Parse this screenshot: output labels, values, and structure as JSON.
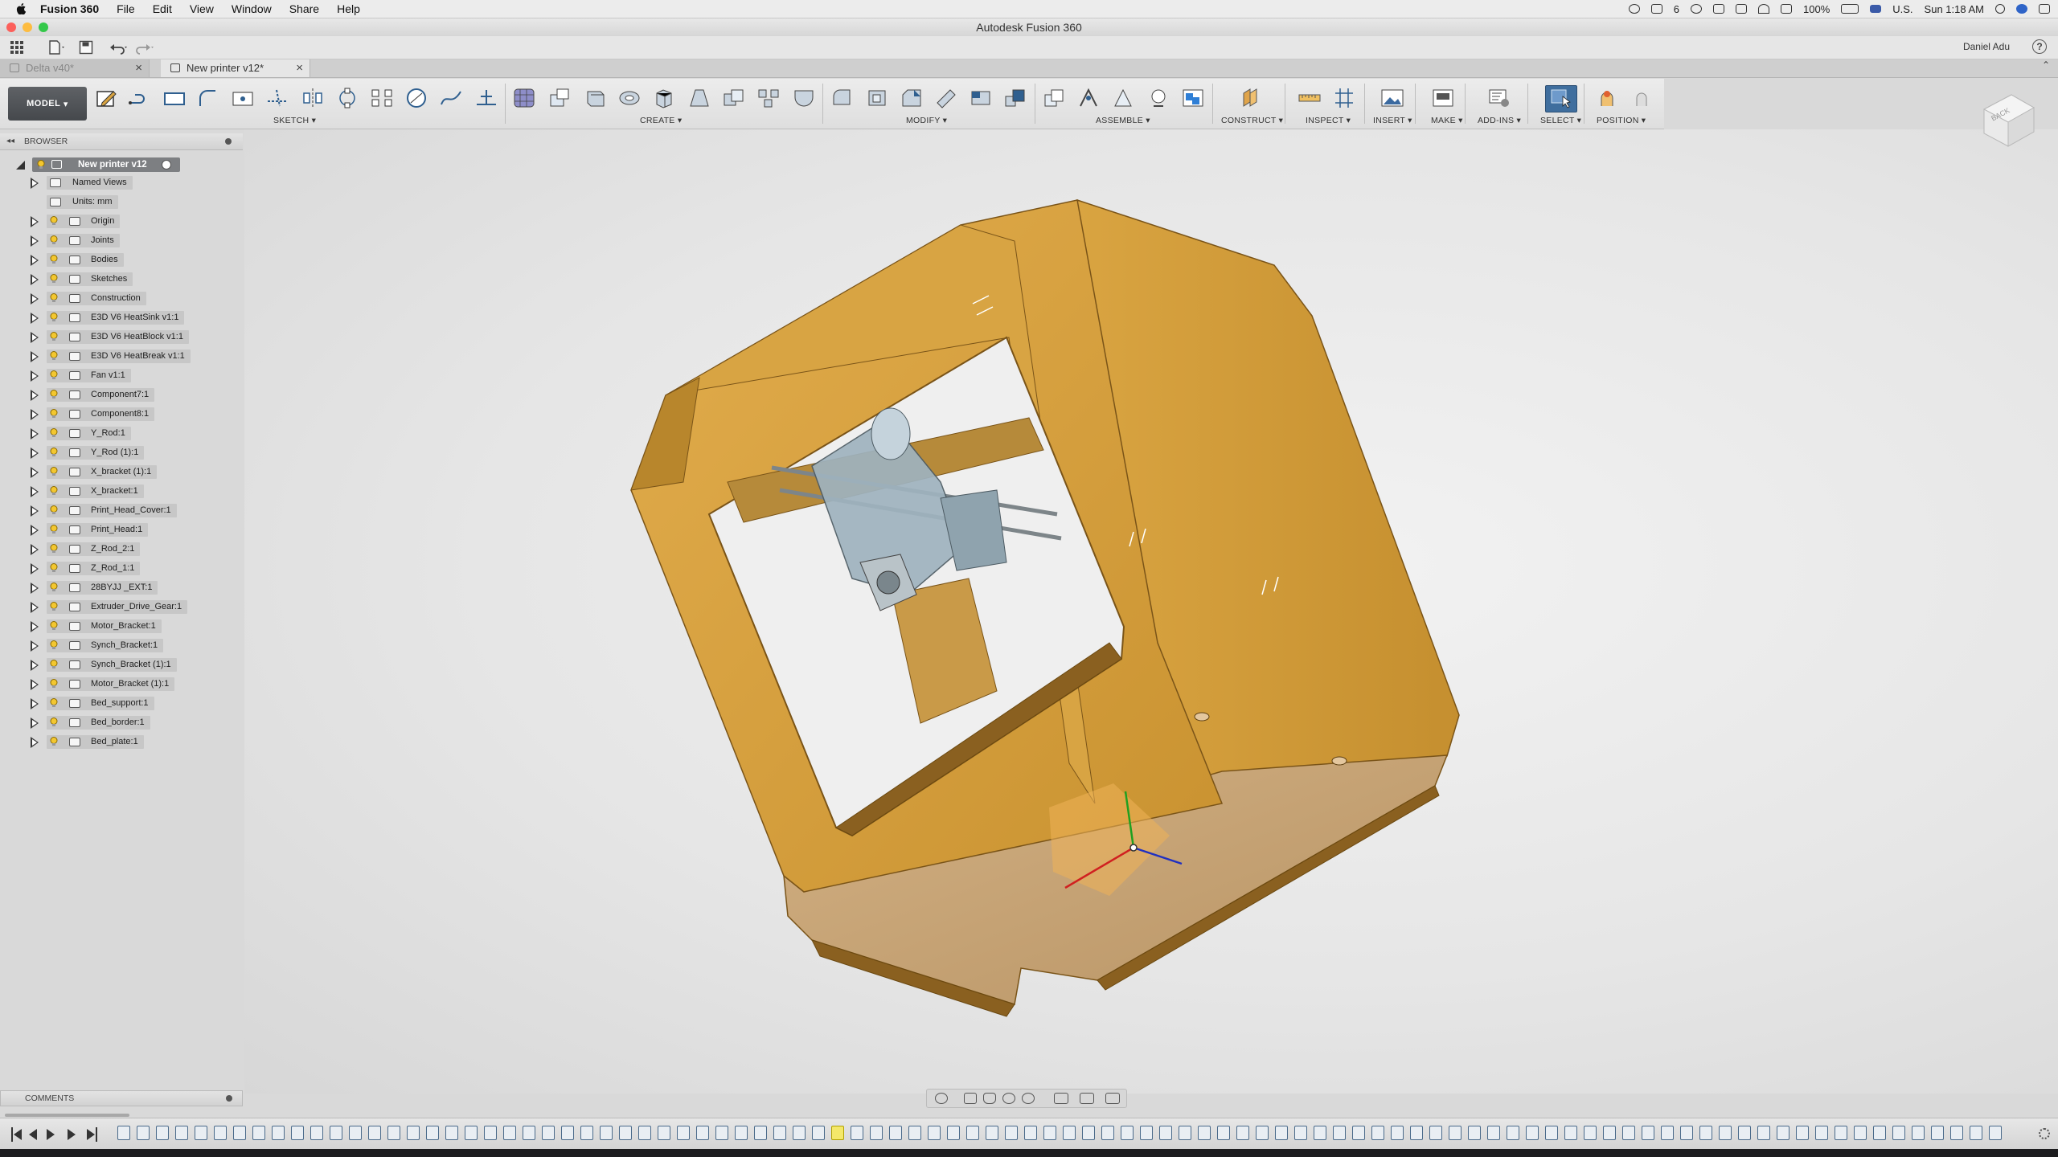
{
  "menubar": {
    "app_name": "Fusion 360",
    "menus": [
      "File",
      "Edit",
      "View",
      "Window",
      "Share",
      "Help"
    ],
    "battery": "100%",
    "input_source": "U.S.",
    "clock": "Sun 1:18 AM",
    "notification_count": "6"
  },
  "window": {
    "title": "Autodesk Fusion 360"
  },
  "quick_access": {
    "user_name": "Daniel Adu",
    "help_label": "?"
  },
  "tabs": [
    {
      "label": "Delta v40*",
      "active": false
    },
    {
      "label": "New printer v12*",
      "active": true
    }
  ],
  "toolbar": {
    "workspace": "MODEL",
    "groups": {
      "sketch": "SKETCH",
      "create": "CREATE",
      "modify": "MODIFY",
      "assemble": "ASSEMBLE",
      "construct": "CONSTRUCT",
      "inspect": "INSPECT",
      "insert": "INSERT",
      "make": "MAKE",
      "add_ins": "ADD-INS",
      "select": "SELECT",
      "position": "POSITION"
    }
  },
  "viewcube": {
    "face": "BACK"
  },
  "browser": {
    "title": "BROWSER",
    "root": "New printer v12",
    "nodes": [
      {
        "label": "Named Views",
        "bulb": false
      },
      {
        "label": "Units: mm",
        "bulb": false,
        "leaf": true
      },
      {
        "label": "Origin",
        "bulb": true
      },
      {
        "label": "Joints",
        "bulb": true
      },
      {
        "label": "Bodies",
        "bulb": true
      },
      {
        "label": "Sketches",
        "bulb": true
      },
      {
        "label": "Construction",
        "bulb": true
      },
      {
        "label": "E3D V6 HeatSink v1:1",
        "bulb": true
      },
      {
        "label": "E3D V6 HeatBlock v1:1",
        "bulb": true
      },
      {
        "label": "E3D V6 HeatBreak v1:1",
        "bulb": true
      },
      {
        "label": "Fan v1:1",
        "bulb": true
      },
      {
        "label": "Component7:1",
        "bulb": true
      },
      {
        "label": "Component8:1",
        "bulb": true
      },
      {
        "label": "Y_Rod:1",
        "bulb": true
      },
      {
        "label": "Y_Rod (1):1",
        "bulb": true
      },
      {
        "label": "X_bracket (1):1",
        "bulb": true
      },
      {
        "label": "X_bracket:1",
        "bulb": true
      },
      {
        "label": "Print_Head_Cover:1",
        "bulb": true
      },
      {
        "label": "Print_Head:1",
        "bulb": true
      },
      {
        "label": "Z_Rod_2:1",
        "bulb": true
      },
      {
        "label": "Z_Rod_1:1",
        "bulb": true
      },
      {
        "label": "28BYJJ _EXT:1",
        "bulb": true
      },
      {
        "label": "Extruder_Drive_Gear:1",
        "bulb": true
      },
      {
        "label": "Motor_Bracket:1",
        "bulb": true
      },
      {
        "label": "Synch_Bracket:1",
        "bulb": true
      },
      {
        "label": "Synch_Bracket (1):1",
        "bulb": true
      },
      {
        "label": "Motor_Bracket (1):1",
        "bulb": true
      },
      {
        "label": "Bed_support:1",
        "bulb": true
      },
      {
        "label": "Bed_border:1",
        "bulb": true
      },
      {
        "label": "Bed_plate:1",
        "bulb": true
      }
    ]
  },
  "comments": {
    "title": "COMMENTS"
  },
  "colors": {
    "frame_light": "#d9a441",
    "frame_mid": "#c8922e",
    "frame_dark": "#9a6a1c",
    "select_active": "#3f6e9e"
  }
}
